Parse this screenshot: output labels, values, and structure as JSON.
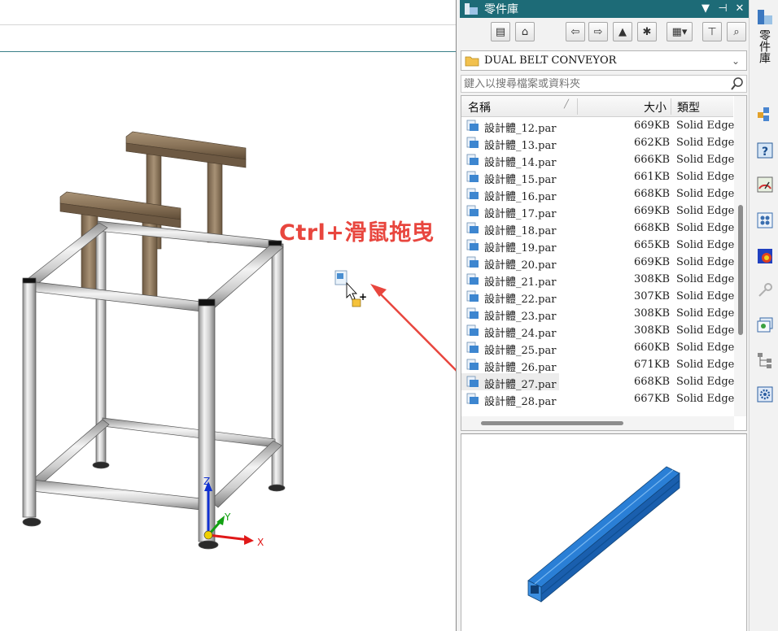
{
  "canvas": {
    "annotation": "Ctrl+滑鼠拖曳",
    "axes": {
      "x": "X",
      "y": "Y",
      "z": "Z"
    }
  },
  "panel": {
    "title": "零件庫",
    "title_buttons": [
      "pin-dropdown-icon",
      "pin-icon",
      "close-icon"
    ],
    "toolbar_icons": [
      "view-folders-icon",
      "home-icon",
      "back-icon",
      "forward-icon",
      "up-folder-icon",
      "new-folder-icon",
      "view-options-icon",
      "filter-icon",
      "search-icon"
    ],
    "folder": "DUAL BELT CONVEYOR",
    "search_placeholder": "鍵入以搜尋檔案或資料夾",
    "columns": {
      "name": "名稱",
      "size": "大小",
      "type": "類型"
    },
    "files": [
      {
        "name": "設計體_12.par",
        "size": "669KB",
        "type": "Solid Edge"
      },
      {
        "name": "設計體_13.par",
        "size": "662KB",
        "type": "Solid Edge"
      },
      {
        "name": "設計體_14.par",
        "size": "666KB",
        "type": "Solid Edge"
      },
      {
        "name": "設計體_15.par",
        "size": "661KB",
        "type": "Solid Edge"
      },
      {
        "name": "設計體_16.par",
        "size": "668KB",
        "type": "Solid Edge"
      },
      {
        "name": "設計體_17.par",
        "size": "669KB",
        "type": "Solid Edge"
      },
      {
        "name": "設計體_18.par",
        "size": "668KB",
        "type": "Solid Edge"
      },
      {
        "name": "設計體_19.par",
        "size": "665KB",
        "type": "Solid Edge"
      },
      {
        "name": "設計體_20.par",
        "size": "669KB",
        "type": "Solid Edge"
      },
      {
        "name": "設計體_21.par",
        "size": "308KB",
        "type": "Solid Edge"
      },
      {
        "name": "設計體_22.par",
        "size": "307KB",
        "type": "Solid Edge"
      },
      {
        "name": "設計體_23.par",
        "size": "308KB",
        "type": "Solid Edge"
      },
      {
        "name": "設計體_24.par",
        "size": "308KB",
        "type": "Solid Edge"
      },
      {
        "name": "設計體_25.par",
        "size": "660KB",
        "type": "Solid Edge"
      },
      {
        "name": "設計體_26.par",
        "size": "671KB",
        "type": "Solid Edge"
      },
      {
        "name": "設計體_27.par",
        "size": "668KB",
        "type": "Solid Edge"
      },
      {
        "name": "設計體_28.par",
        "size": "667KB",
        "type": "Solid Edge"
      }
    ],
    "selected_index": 15
  },
  "side_strip": {
    "tab_label": "零件庫",
    "buttons": [
      "parts-library-icon",
      "assembly-icon",
      "help-icon",
      "sensor-icon",
      "layers-icon",
      "color-map-icon",
      "key-icon",
      "views-icon",
      "tree-icon",
      "settings-icon"
    ]
  },
  "colors": {
    "titlebar": "#1d6b77",
    "annotation": "#e8463e",
    "preview_part": "#2a7fd6"
  }
}
